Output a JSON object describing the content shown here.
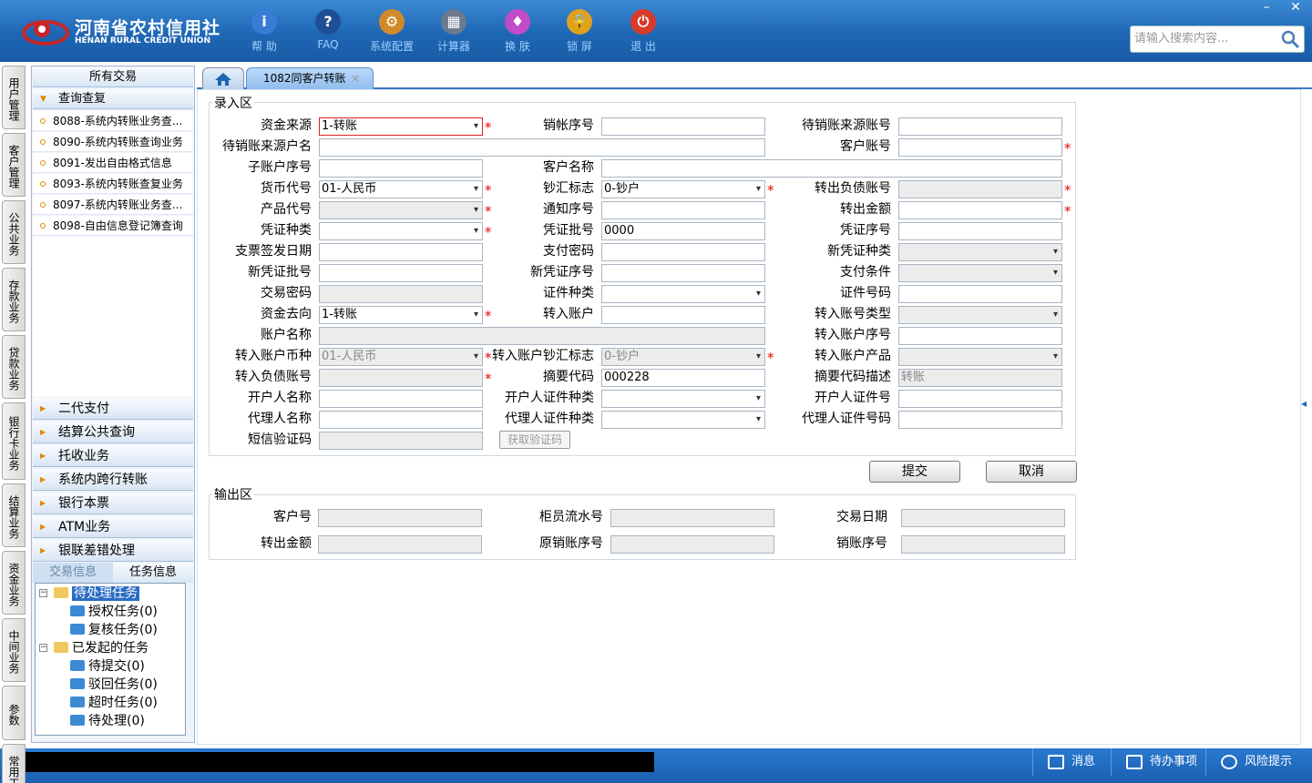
{
  "header": {
    "logo_cn": "河南省农村信用社",
    "logo_en": "HENAN RURAL CREDIT UNION",
    "toolbar": [
      {
        "label": "帮 助",
        "icon": "help-icon",
        "glyph": "i",
        "color": "#3a7bd5"
      },
      {
        "label": "FAQ",
        "icon": "faq-icon",
        "glyph": "?",
        "color": "#1d4f96"
      },
      {
        "label": "系统配置",
        "icon": "config-icon",
        "glyph": "⚙",
        "color": "#d08a2a"
      },
      {
        "label": "计算器",
        "icon": "calculator-icon",
        "glyph": "▦",
        "color": "#6b7a8f"
      },
      {
        "label": "换 肤",
        "icon": "skin-icon",
        "glyph": "♦",
        "color": "#c04cc8"
      },
      {
        "label": "锁 屏",
        "icon": "lock-icon",
        "glyph": "🔒",
        "color": "#e0a020"
      },
      {
        "label": "退 出",
        "icon": "exit-icon",
        "glyph": "⏻",
        "color": "#d83a2a"
      }
    ],
    "search_placeholder": "请输入搜索内容..."
  },
  "window_controls": {
    "minimize": "–",
    "close": "✕"
  },
  "vtabs": [
    "用户管理",
    "客户管理",
    "公共业务",
    "存款业务",
    "贷款业务",
    "银行卡业务",
    "结算业务",
    "资金业务",
    "中间业务",
    "参数",
    "常用工具"
  ],
  "panel": {
    "title": "所有交易",
    "open_group": "查询查复",
    "items": [
      "8088-系统内转账业务查...",
      "8090-系统内转账查询业务",
      "8091-发出自由格式信息",
      "8093-系统内转账查复业务",
      "8097-系统内转账业务查...",
      "8098-自由信息登记簿查询"
    ],
    "groups": [
      "二代支付",
      "结算公共查询",
      "托收业务",
      "系统内跨行转账",
      "银行本票",
      "ATM业务",
      "银联差错处理"
    ],
    "bottom_tabs": [
      "交易信息",
      "任务信息"
    ],
    "tree": [
      {
        "label": "待处理任务",
        "level": 0,
        "selected": true
      },
      {
        "label": "授权任务(0)",
        "level": 1
      },
      {
        "label": "复核任务(0)",
        "level": 1
      },
      {
        "label": "已发起的任务",
        "level": 0
      },
      {
        "label": "待提交(0)",
        "level": 1
      },
      {
        "label": "驳回任务(0)",
        "level": 1
      },
      {
        "label": "超时任务(0)",
        "level": 1
      },
      {
        "label": "待处理(0)",
        "level": 1
      }
    ]
  },
  "tabs": {
    "active": "1082同客户转账",
    "close": "×"
  },
  "input_area": {
    "legend": "录入区",
    "fields": [
      {
        "label": "资金来源",
        "value": "1-转账",
        "dd": true,
        "req": true,
        "red": true
      },
      {
        "label": "销帐序号",
        "value": ""
      },
      {
        "label": "待销账来源账号",
        "value": ""
      },
      {
        "label": "待销账来源户名",
        "value": "",
        "wide": true
      },
      {
        "label": "客户账号",
        "value": "",
        "req": true
      },
      {
        "label": "子账户序号",
        "value": ""
      },
      {
        "label": "客户名称",
        "value": "",
        "wide": true
      },
      {
        "label": "货币代号",
        "value": "01-人民币",
        "dd": true,
        "req": true
      },
      {
        "label": "钞汇标志",
        "value": "0-钞户",
        "dd": true,
        "req": true
      },
      {
        "label": "转出负债账号",
        "value": "",
        "dis": true,
        "req": true
      },
      {
        "label": "产品代号",
        "value": "",
        "dd": true,
        "dis": true,
        "req": true
      },
      {
        "label": "通知序号",
        "value": ""
      },
      {
        "label": "转出金额",
        "value": "",
        "req": true
      },
      {
        "label": "凭证种类",
        "value": "",
        "dd": true,
        "req": true
      },
      {
        "label": "凭证批号",
        "value": "0000"
      },
      {
        "label": "凭证序号",
        "value": ""
      },
      {
        "label": "支票签发日期",
        "value": ""
      },
      {
        "label": "支付密码",
        "value": ""
      },
      {
        "label": "新凭证种类",
        "value": "",
        "dd": true,
        "dis": true
      },
      {
        "label": "新凭证批号",
        "value": ""
      },
      {
        "label": "新凭证序号",
        "value": ""
      },
      {
        "label": "支付条件",
        "value": "",
        "dd": true,
        "dis": true
      },
      {
        "label": "交易密码",
        "value": "",
        "dis": true
      },
      {
        "label": "证件种类",
        "value": "",
        "dd": true
      },
      {
        "label": "证件号码",
        "value": ""
      },
      {
        "label": "资金去向",
        "value": "1-转账",
        "dd": true,
        "req": true
      },
      {
        "label": "转入账户",
        "value": ""
      },
      {
        "label": "转入账号类型",
        "value": "",
        "dd": true,
        "dis": true
      },
      {
        "label": "账户名称",
        "value": "",
        "dis": true,
        "wide": true
      },
      {
        "label": "转入账户序号",
        "value": ""
      },
      {
        "label": "转入账户币种",
        "value": "01-人民币",
        "dd": true,
        "dis": true,
        "req": true
      },
      {
        "label": "转入账户钞汇标志",
        "value": "0-钞户",
        "dd": true,
        "dis": true,
        "req": true
      },
      {
        "label": "转入账户产品",
        "value": "",
        "dd": true,
        "dis": true
      },
      {
        "label": "转入负债账号",
        "value": "",
        "dis": true,
        "req": true
      },
      {
        "label": "摘要代码",
        "value": "000228"
      },
      {
        "label": "摘要代码描述",
        "value": "转账",
        "dis": true
      },
      {
        "label": "开户人名称",
        "value": ""
      },
      {
        "label": "开户人证件种类",
        "value": "",
        "dd": true
      },
      {
        "label": "开户人证件号",
        "value": ""
      },
      {
        "label": "代理人名称",
        "value": ""
      },
      {
        "label": "代理人证件种类",
        "value": "",
        "dd": true
      },
      {
        "label": "代理人证件号码",
        "value": ""
      },
      {
        "label": "短信验证码",
        "value": "",
        "dis": true
      }
    ],
    "vcode_button": "获取验证码"
  },
  "buttons": {
    "submit": "提交",
    "cancel": "取消"
  },
  "output_area": {
    "legend": "输出区",
    "fields": [
      "客户号",
      "柜员流水号",
      "交易日期",
      "转出金额",
      "原销账序号",
      "销账序号"
    ]
  },
  "statusbar": [
    {
      "label": "消息",
      "icon": "mail-icon"
    },
    {
      "label": "待办事项",
      "icon": "checkbox-icon"
    },
    {
      "label": "风险提示",
      "icon": "chat-icon"
    }
  ]
}
